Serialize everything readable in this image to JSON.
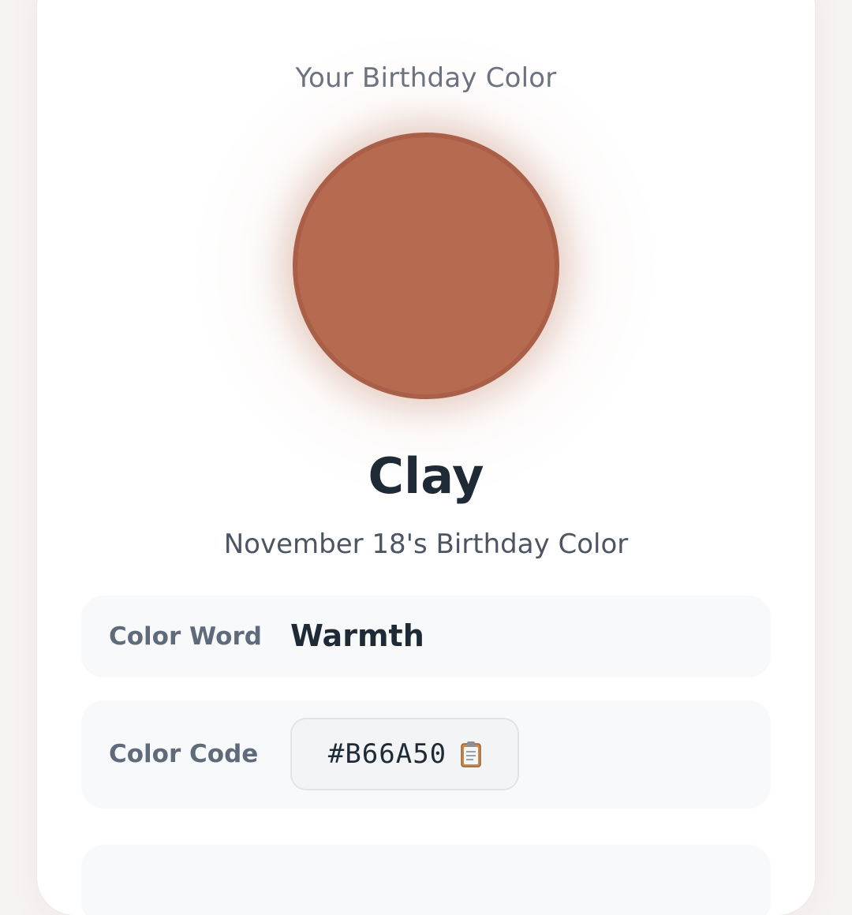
{
  "header": {
    "eyebrow": "Your Birthday Color"
  },
  "color": {
    "name": "Clay",
    "hex": "#B66A50",
    "subtitle": "November 18's Birthday Color"
  },
  "details": {
    "color_word_label": "Color Word",
    "color_word_value": "Warmth",
    "color_code_label": "Color Code",
    "color_code_value": "#B66A50",
    "copy_icon": "clipboard-icon"
  },
  "theme": {
    "accent": "#B66A50",
    "text_dark": "#1F2A37",
    "text_muted": "#6B7280",
    "row_bg": "#F8F9FB"
  }
}
